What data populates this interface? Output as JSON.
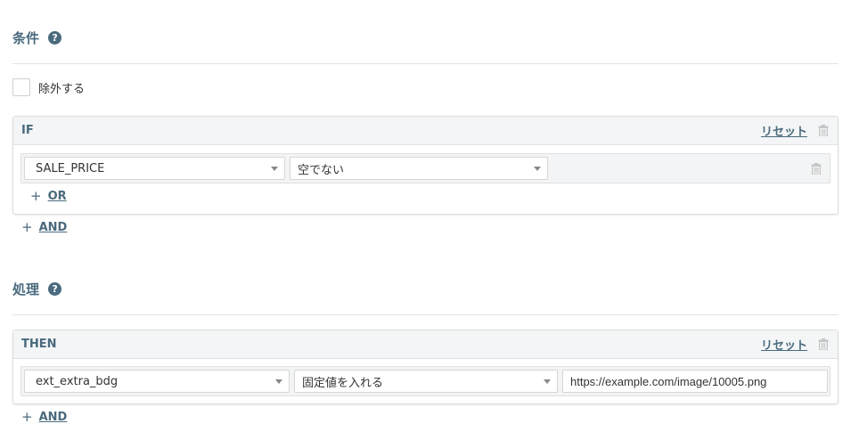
{
  "conditions": {
    "title": "条件",
    "help_icon": "?",
    "exclude_label": "除外する",
    "if_panel": {
      "title": "IF",
      "reset_label": "リセット",
      "row": {
        "field": "SALE_PRICE",
        "operator": "空でない"
      },
      "or_label": "OR"
    },
    "and_label": "AND"
  },
  "processing": {
    "title": "処理",
    "help_icon": "?",
    "then_panel": {
      "title": "THEN",
      "reset_label": "リセット",
      "row": {
        "field": "ext_extra_bdg",
        "action": "固定値を入れる",
        "value": "https://example.com/image/10005.png"
      }
    },
    "and_label": "AND"
  },
  "colors": {
    "accent": "#4a6a7d",
    "panel_header_bg": "#f3f5f6",
    "border": "#dcdcdc"
  },
  "icons": {
    "help": "question-circle-icon",
    "delete": "trash-icon",
    "add": "plus-icon",
    "dropdown": "caret-down-icon"
  }
}
